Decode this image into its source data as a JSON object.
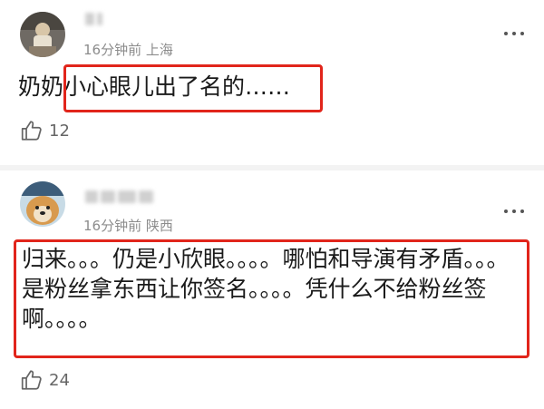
{
  "comments": [
    {
      "location_time": "16分钟前 上海",
      "text": "奶奶小心眼儿出了名的……",
      "likes": "12"
    },
    {
      "location_time": "16分钟前 陕西",
      "text": "归来。。。仍是小欣眼。。。。哪怕和导演有矛盾。。。是粉丝拿东西让你签名。。。。凭什么不给粉丝签啊。。。。",
      "likes": "24"
    }
  ],
  "colors": {
    "highlight": "#e1251b",
    "meta": "#8c8c8c",
    "divider": "#f3f3f3"
  },
  "icons": {
    "like": "thumbs-up-icon",
    "more": "more-icon"
  }
}
